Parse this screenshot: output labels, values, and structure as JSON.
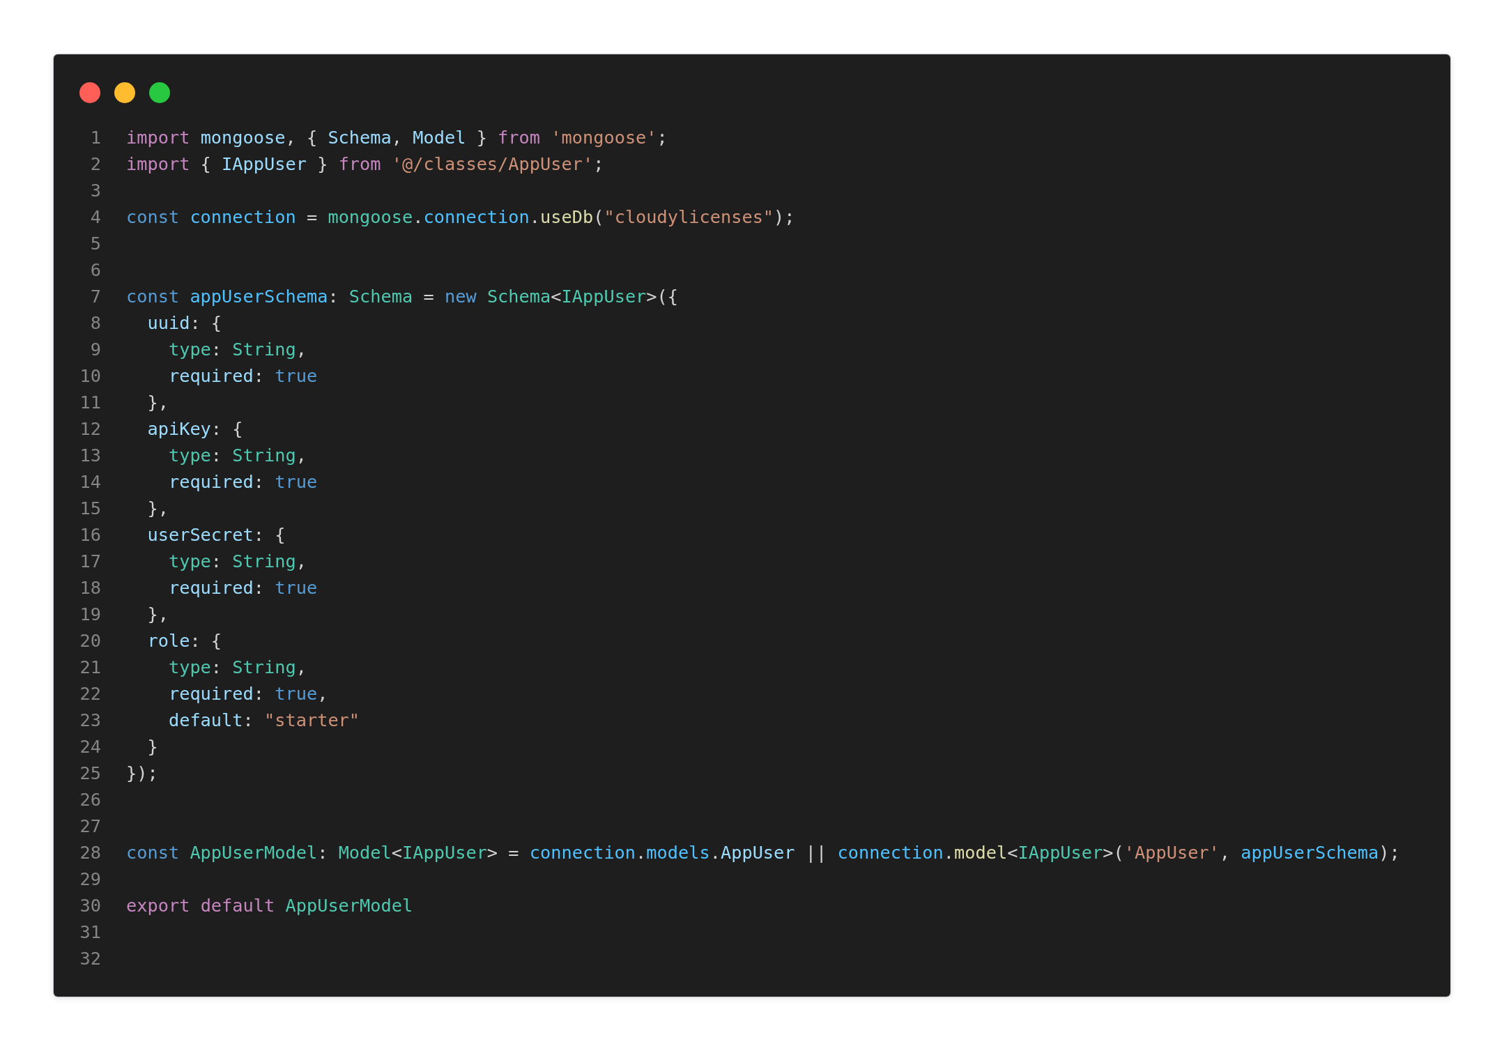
{
  "window_controls": [
    {
      "color": "#ff5f57"
    },
    {
      "color": "#febc2e"
    },
    {
      "color": "#28c840"
    }
  ],
  "lines": [
    {
      "number": "1",
      "tokens": [
        {
          "kind": "keyword",
          "text": "import "
        },
        {
          "kind": "variable",
          "text": "mongoose"
        },
        {
          "kind": "plain",
          "text": ", { "
        },
        {
          "kind": "variable",
          "text": "Schema"
        },
        {
          "kind": "plain",
          "text": ", "
        },
        {
          "kind": "variable",
          "text": "Model"
        },
        {
          "kind": "plain",
          "text": " } "
        },
        {
          "kind": "keyword",
          "text": "from "
        },
        {
          "kind": "string",
          "text": "'mongoose'"
        },
        {
          "kind": "plain",
          "text": ";"
        }
      ]
    },
    {
      "number": "2",
      "tokens": [
        {
          "kind": "keyword",
          "text": "import"
        },
        {
          "kind": "plain",
          "text": " { "
        },
        {
          "kind": "variable",
          "text": "IAppUser"
        },
        {
          "kind": "plain",
          "text": " } "
        },
        {
          "kind": "keyword",
          "text": "from "
        },
        {
          "kind": "string",
          "text": "'@/classes/AppUser'"
        },
        {
          "kind": "plain",
          "text": ";"
        }
      ]
    },
    {
      "number": "3"
    },
    {
      "number": "4",
      "tokens": [
        {
          "kind": "storage",
          "text": "const "
        },
        {
          "kind": "constant",
          "text": "connection"
        },
        {
          "kind": "plain",
          "text": " = "
        },
        {
          "kind": "type",
          "text": "mongoose"
        },
        {
          "kind": "plain",
          "text": "."
        },
        {
          "kind": "constant",
          "text": "connection"
        },
        {
          "kind": "plain",
          "text": "."
        },
        {
          "kind": "function",
          "text": "useDb"
        },
        {
          "kind": "plain",
          "text": "("
        },
        {
          "kind": "string",
          "text": "\"cloudylicenses\""
        },
        {
          "kind": "plain",
          "text": ");"
        }
      ]
    },
    {
      "number": "5"
    },
    {
      "number": "6"
    },
    {
      "number": "7",
      "tokens": [
        {
          "kind": "storage",
          "text": "const "
        },
        {
          "kind": "constant",
          "text": "appUserSchema"
        },
        {
          "kind": "plain",
          "text": ": "
        },
        {
          "kind": "type",
          "text": "Schema"
        },
        {
          "kind": "plain",
          "text": " = "
        },
        {
          "kind": "storage",
          "text": "new "
        },
        {
          "kind": "type",
          "text": "Schema"
        },
        {
          "kind": "plain",
          "text": "<"
        },
        {
          "kind": "type",
          "text": "IAppUser"
        },
        {
          "kind": "plain",
          "text": ">({"
        }
      ]
    },
    {
      "number": "8",
      "tokens": [
        {
          "kind": "variable",
          "text": "  uuid"
        },
        {
          "kind": "plain",
          "text": ": {"
        }
      ]
    },
    {
      "number": "9",
      "tokens": [
        {
          "kind": "type",
          "text": "    type"
        },
        {
          "kind": "plain",
          "text": ": "
        },
        {
          "kind": "type",
          "text": "String"
        },
        {
          "kind": "plain",
          "text": ","
        }
      ]
    },
    {
      "number": "10",
      "tokens": [
        {
          "kind": "variable",
          "text": "    required"
        },
        {
          "kind": "plain",
          "text": ": "
        },
        {
          "kind": "storage",
          "text": "true"
        }
      ]
    },
    {
      "number": "11",
      "tokens": [
        {
          "kind": "plain",
          "text": "  },"
        }
      ]
    },
    {
      "number": "12",
      "tokens": [
        {
          "kind": "variable",
          "text": "  apiKey"
        },
        {
          "kind": "plain",
          "text": ": {"
        }
      ]
    },
    {
      "number": "13",
      "tokens": [
        {
          "kind": "type",
          "text": "    type"
        },
        {
          "kind": "plain",
          "text": ": "
        },
        {
          "kind": "type",
          "text": "String"
        },
        {
          "kind": "plain",
          "text": ","
        }
      ]
    },
    {
      "number": "14",
      "tokens": [
        {
          "kind": "variable",
          "text": "    required"
        },
        {
          "kind": "plain",
          "text": ": "
        },
        {
          "kind": "storage",
          "text": "true"
        }
      ]
    },
    {
      "number": "15",
      "tokens": [
        {
          "kind": "plain",
          "text": "  },"
        }
      ]
    },
    {
      "number": "16",
      "tokens": [
        {
          "kind": "variable",
          "text": "  userSecret"
        },
        {
          "kind": "plain",
          "text": ": {"
        }
      ]
    },
    {
      "number": "17",
      "tokens": [
        {
          "kind": "type",
          "text": "    type"
        },
        {
          "kind": "plain",
          "text": ": "
        },
        {
          "kind": "type",
          "text": "String"
        },
        {
          "kind": "plain",
          "text": ","
        }
      ]
    },
    {
      "number": "18",
      "tokens": [
        {
          "kind": "variable",
          "text": "    required"
        },
        {
          "kind": "plain",
          "text": ": "
        },
        {
          "kind": "storage",
          "text": "true"
        }
      ]
    },
    {
      "number": "19",
      "tokens": [
        {
          "kind": "plain",
          "text": "  },"
        }
      ]
    },
    {
      "number": "20",
      "tokens": [
        {
          "kind": "variable",
          "text": "  role"
        },
        {
          "kind": "plain",
          "text": ": {"
        }
      ]
    },
    {
      "number": "21",
      "tokens": [
        {
          "kind": "type",
          "text": "    type"
        },
        {
          "kind": "plain",
          "text": ": "
        },
        {
          "kind": "type",
          "text": "String"
        },
        {
          "kind": "plain",
          "text": ","
        }
      ]
    },
    {
      "number": "22",
      "tokens": [
        {
          "kind": "variable",
          "text": "    required"
        },
        {
          "kind": "plain",
          "text": ": "
        },
        {
          "kind": "storage",
          "text": "true"
        },
        {
          "kind": "plain",
          "text": ","
        }
      ]
    },
    {
      "number": "23",
      "tokens": [
        {
          "kind": "variable",
          "text": "    default"
        },
        {
          "kind": "plain",
          "text": ": "
        },
        {
          "kind": "string",
          "text": "\"starter\""
        }
      ]
    },
    {
      "number": "24",
      "tokens": [
        {
          "kind": "plain",
          "text": "  }"
        }
      ]
    },
    {
      "number": "25",
      "tokens": [
        {
          "kind": "plain",
          "text": "});"
        }
      ]
    },
    {
      "number": "26"
    },
    {
      "number": "27"
    },
    {
      "number": "28",
      "tokens": [
        {
          "kind": "storage",
          "text": "const "
        },
        {
          "kind": "type",
          "text": "AppUserModel"
        },
        {
          "kind": "plain",
          "text": ": "
        },
        {
          "kind": "type",
          "text": "Model"
        },
        {
          "kind": "plain",
          "text": "<"
        },
        {
          "kind": "type",
          "text": "IAppUser"
        },
        {
          "kind": "plain",
          "text": "> = "
        },
        {
          "kind": "constant",
          "text": "connection"
        },
        {
          "kind": "plain",
          "text": "."
        },
        {
          "kind": "constant",
          "text": "models"
        },
        {
          "kind": "plain",
          "text": "."
        },
        {
          "kind": "variable",
          "text": "AppUser"
        },
        {
          "kind": "plain",
          "text": " || "
        },
        {
          "kind": "constant",
          "text": "connection"
        },
        {
          "kind": "plain",
          "text": "."
        },
        {
          "kind": "function",
          "text": "model"
        },
        {
          "kind": "plain",
          "text": "<"
        },
        {
          "kind": "type",
          "text": "IAppUser"
        },
        {
          "kind": "plain",
          "text": ">("
        },
        {
          "kind": "string",
          "text": "'AppUser'"
        },
        {
          "kind": "plain",
          "text": ", "
        },
        {
          "kind": "constant",
          "text": "appUserSchema"
        },
        {
          "kind": "plain",
          "text": ");"
        }
      ]
    },
    {
      "number": "29"
    },
    {
      "number": "30",
      "tokens": [
        {
          "kind": "keyword",
          "text": "export "
        },
        {
          "kind": "keyword",
          "text": "default "
        },
        {
          "kind": "type",
          "text": "AppUserModel"
        }
      ]
    },
    {
      "number": "31"
    },
    {
      "number": "32"
    }
  ]
}
